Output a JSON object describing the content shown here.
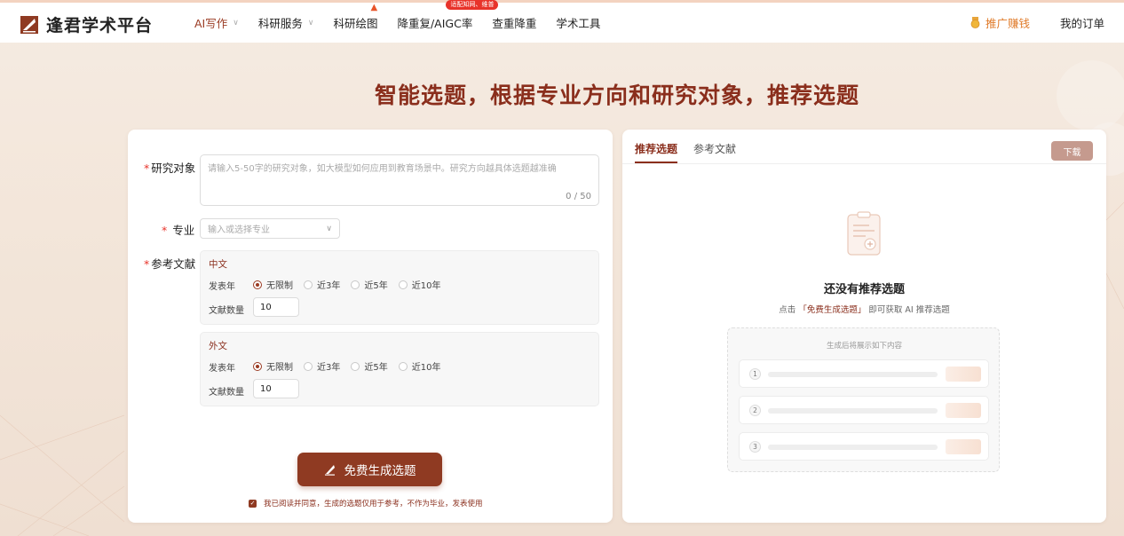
{
  "header": {
    "logo_text": "逢君学术平台",
    "nav": [
      {
        "label": "AI写作",
        "has_dropdown": true,
        "active": true
      },
      {
        "label": "科研服务",
        "has_dropdown": true
      },
      {
        "label": "科研绘图",
        "hot": true
      },
      {
        "label": "降重复/AIGC率",
        "badge": "适配知网、维普"
      },
      {
        "label": "查重降重"
      },
      {
        "label": "学术工具"
      }
    ],
    "promo_label": "推广赚钱",
    "orders_label": "我的订单"
  },
  "page_title": "智能选题，根据专业方向和研究对象，推荐选题",
  "form": {
    "research_label": "研究对象",
    "research_placeholder": "请输入5-50字的研究对象，如大模型如何应用到教育场景中。研究方向越具体选题越准确",
    "research_count": "0 / 50",
    "major_label": "专业",
    "major_placeholder": "输入或选择专业",
    "refs_label": "参考文献",
    "refs": [
      {
        "title": "中文",
        "year_label": "发表年",
        "year_options": [
          "无限制",
          "近3年",
          "近5年",
          "近10年"
        ],
        "selected": 0,
        "count_label": "文献数量",
        "count_value": "10"
      },
      {
        "title": "外文",
        "year_label": "发表年",
        "year_options": [
          "无限制",
          "近3年",
          "近5年",
          "近10年"
        ],
        "selected": 0,
        "count_label": "文献数量",
        "count_value": "10"
      }
    ],
    "generate_label": "免费生成选题",
    "agree_text": "我已阅读并同意，生成的选题仅用于参考，不作为毕业，发表使用"
  },
  "result": {
    "tabs": [
      "推荐选题",
      "参考文献"
    ],
    "download_label": "下载",
    "empty_title": "还没有推荐选题",
    "hint_prefix": "点击 ",
    "hint_highlight": "「免费生成选题」",
    "hint_suffix": " 即可获取 AI 推荐选题",
    "preview_caption": "生成后将展示如下内容",
    "preview_rows": [
      "1",
      "2",
      "3"
    ]
  },
  "colors": {
    "brand": "#8f3a22",
    "accent_orange": "#e07b2a",
    "badge_red": "#e8332a"
  }
}
